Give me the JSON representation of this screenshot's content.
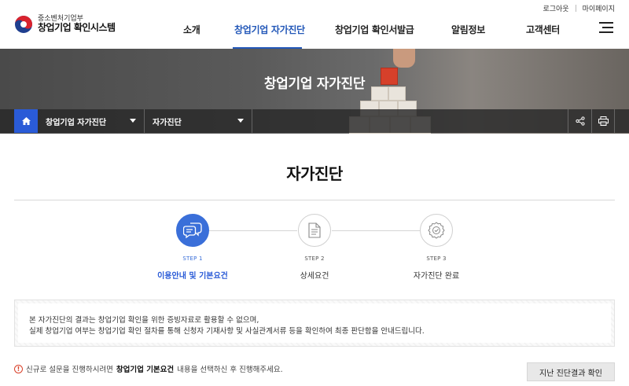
{
  "util": {
    "logout": "로그아웃",
    "mypage": "마이페이지"
  },
  "logo": {
    "ministry": "중소벤처기업부",
    "system": "창업기업 확인시스템"
  },
  "gnb": {
    "items": [
      "소개",
      "창업기업 자가진단",
      "창업기업 확인서발급",
      "알림정보",
      "고객센터"
    ],
    "active_index": 1
  },
  "banner": {
    "title": "창업기업 자가진단"
  },
  "location": {
    "depth1": "창업기업 자가진단",
    "depth2": "자가진단"
  },
  "page": {
    "title": "자가진단"
  },
  "steps": [
    {
      "num": "STEP 1",
      "label": "이용안내 및 기본요건",
      "active": true,
      "icon": "chat-bubbles-icon"
    },
    {
      "num": "STEP 2",
      "label": "상세요건",
      "active": false,
      "icon": "document-icon"
    },
    {
      "num": "STEP 3",
      "label": "자가진단 완료",
      "active": false,
      "icon": "award-badge-icon"
    }
  ],
  "notice": {
    "line1": "본 자가진단의 결과는 창업기업 확인을 위한 증빙자료로 활용할 수 없으며,",
    "line2": "실제 창업기업 여부는 창업기업 확인 절차를 통해 신청자 기재사항 및 사실관계서류 등을 확인하여 최종 판단함을 안내드립니다."
  },
  "bottom": {
    "warn_symbol": "!",
    "text_before": "신규로 설문을 진행하시려면 ",
    "text_bold": "창업기업 기본요건",
    "text_after": " 내용을 선택하신 후 진행해주세요.",
    "history_button": "지난 진단결과 확인"
  },
  "colors": {
    "accent": "#2a5bd7",
    "active_step": "#3a6fd9",
    "warning": "#d9412a"
  }
}
